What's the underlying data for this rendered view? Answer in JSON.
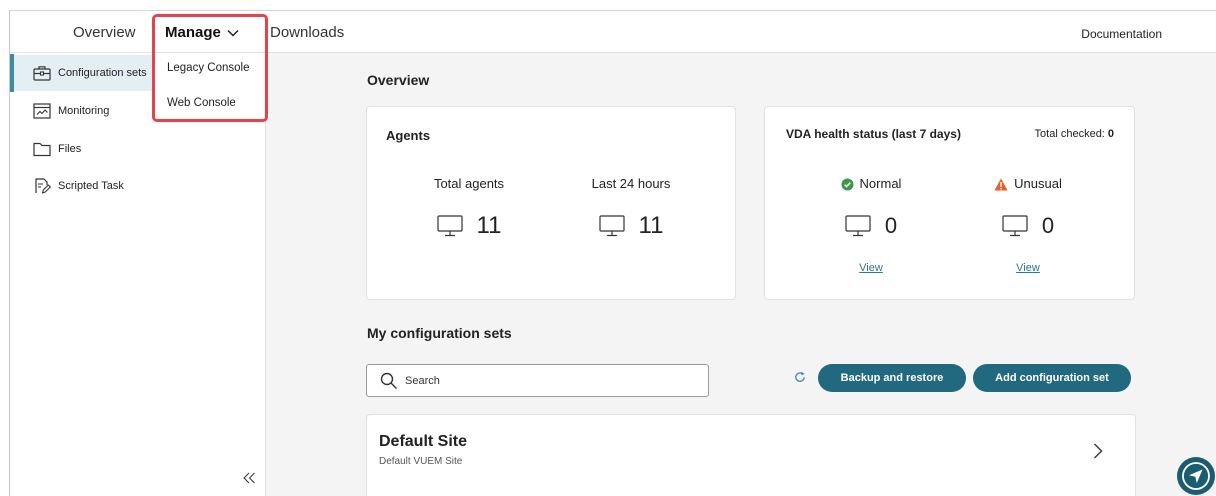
{
  "topnav": {
    "overview": "Overview",
    "manage": "Manage",
    "manage_icon": "chevron-down-icon",
    "downloads": "Downloads",
    "documentation": "Documentation"
  },
  "manage_menu": {
    "items": [
      "Legacy Console",
      "Web Console"
    ]
  },
  "sidebar": {
    "items": [
      {
        "label": "Configuration sets",
        "icon": "configuration-sets-icon",
        "selected": true
      },
      {
        "label": "Monitoring",
        "icon": "monitoring-icon",
        "selected": false
      },
      {
        "label": "Files",
        "icon": "folder-icon",
        "selected": false
      },
      {
        "label": "Scripted Task",
        "icon": "scripted-task-icon",
        "selected": false
      }
    ],
    "collapse_icon": "double-chevron-left-icon"
  },
  "overview": {
    "title": "Overview",
    "agents": {
      "title": "Agents",
      "total_label": "Total agents",
      "total_value": "11",
      "recent_label": "Last 24 hours",
      "recent_value": "11",
      "icon": "monitor-icon"
    },
    "vda_health": {
      "title": "VDA health status (last 7 days)",
      "total_checked_label": "Total checked:",
      "total_checked_value": "0",
      "normal_label": "Normal",
      "normal_icon": "check-circle-icon",
      "normal_value": "0",
      "normal_link": "View",
      "unusual_label": "Unusual",
      "unusual_icon": "warning-icon",
      "unusual_value": "0",
      "unusual_link": "View"
    }
  },
  "configuration_sets": {
    "title": "My configuration sets",
    "search_placeholder": "Search",
    "refresh_icon": "refresh-icon",
    "backup_button": "Backup and restore",
    "add_button": "Add configuration set",
    "items": [
      {
        "name": "Default Site",
        "description": "Default VUEM Site",
        "icon": "chevron-right-icon"
      }
    ]
  },
  "floating_button_icon": "navigation-icon",
  "colors": {
    "accent": "#21697f",
    "selected_background": "#e3eff3",
    "selected_bar": "#3b8ca5",
    "highlight_border": "#e3434b",
    "page_background": "#f4f4f4",
    "normal_status": "#3a9a48",
    "unusual_status": "#e5622a",
    "link": "#2a7893",
    "floating_button": "#1c5c70"
  }
}
